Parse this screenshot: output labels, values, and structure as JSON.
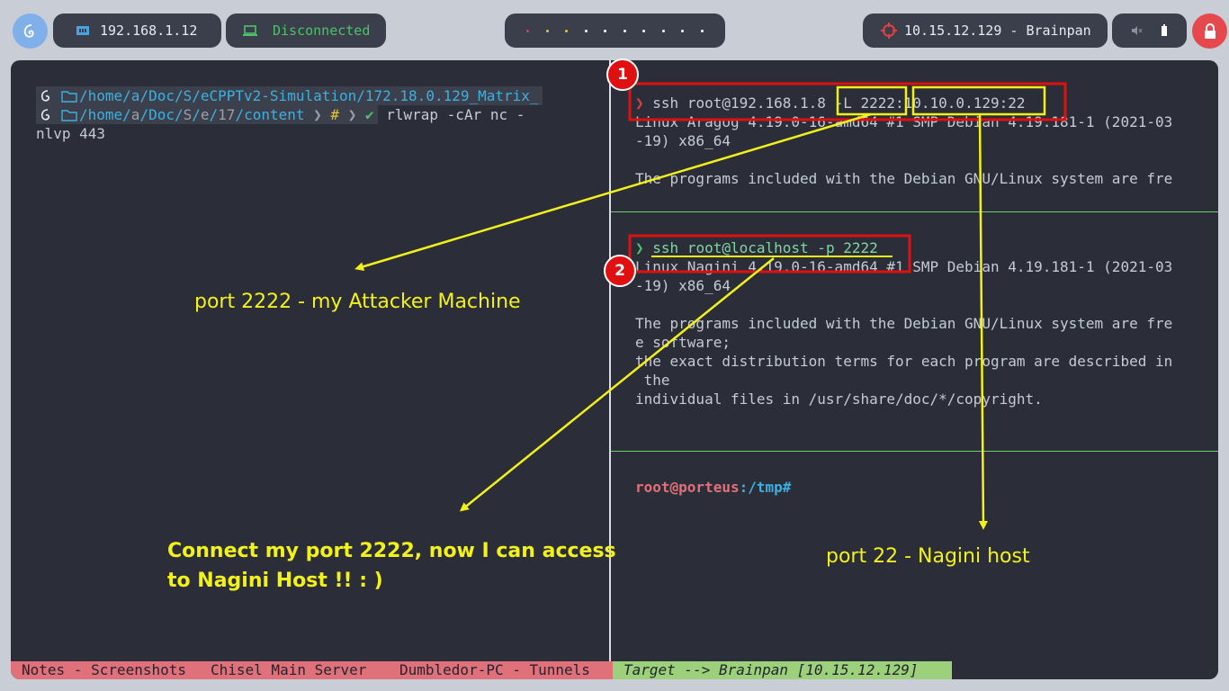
{
  "topbar": {
    "ip": "192.168.1.12",
    "vpn_status": "Disconnected",
    "target": "10.15.12.129 - Brainpan",
    "workspace_dots": [
      "red",
      "yellow",
      "yellow",
      "white",
      "white",
      "white",
      "white",
      "white",
      "white",
      "white"
    ]
  },
  "left_pane": {
    "path1": "/home/a/Doc/S/eCPPTv2-Simulation/172.18.0.129_Matrix_",
    "path2_parts": [
      "/home/",
      "a",
      "/Doc/",
      "S",
      "/",
      "e",
      "/",
      "17",
      "/",
      "content"
    ],
    "hash": "#",
    "check": "✔",
    "command_line1": " rlwrap -cAr nc -",
    "command_line2": "nlvp 443"
  },
  "right_top": {
    "prompt": "❯",
    "cmd": "ssh root@192.168.1.8 -L 2222:10.10.0.129:22",
    "line1": "Linux Aragog 4.19.0-16-amd64 #1 SMP Debian 4.19.181-1 (2021-03",
    "line2": "-19) x86_64",
    "line3": "The programs included with the Debian GNU/Linux system are fre"
  },
  "right_mid": {
    "prompt": "❯",
    "cmd": "ssh root@localhost -p 2222",
    "line1": "Linux Nagini 4.19.0-16-amd64 #1 SMP Debian 4.19.181-1 (2021-03",
    "line2": "-19) x86_64",
    "line3": "The programs included with the Debian GNU/Linux system are fre",
    "line4": "e software;",
    "line5": "the exact distribution terms for each program are described in",
    "line6": " the",
    "line7": "individual files in /usr/share/doc/*/copyright."
  },
  "right_bottom": {
    "user_host": "root@porteus",
    "path": ":/tmp#"
  },
  "statusbar": {
    "tabs": [
      "Notes - Screenshots",
      "Chisel Main Server",
      "Dumbledor-PC - Tunnels",
      "Target --> Brainpan [10.15.12.129]"
    ]
  },
  "annotations": {
    "badge1": "1",
    "badge2": "2",
    "port2222": "port 2222 - my Attacker Machine",
    "connect_line1": "Connect my port 2222, now I can access",
    "connect_line2": "to Nagini Host !! : )",
    "port22": "port 22 - Nagini host"
  },
  "colors": {
    "annotation_yellow": "#f2f21a",
    "annotation_red": "#e01010",
    "pane_divider_green": "#6ccf6c",
    "tab_pink": "#e0707a",
    "tab_green": "#9cd07a"
  }
}
